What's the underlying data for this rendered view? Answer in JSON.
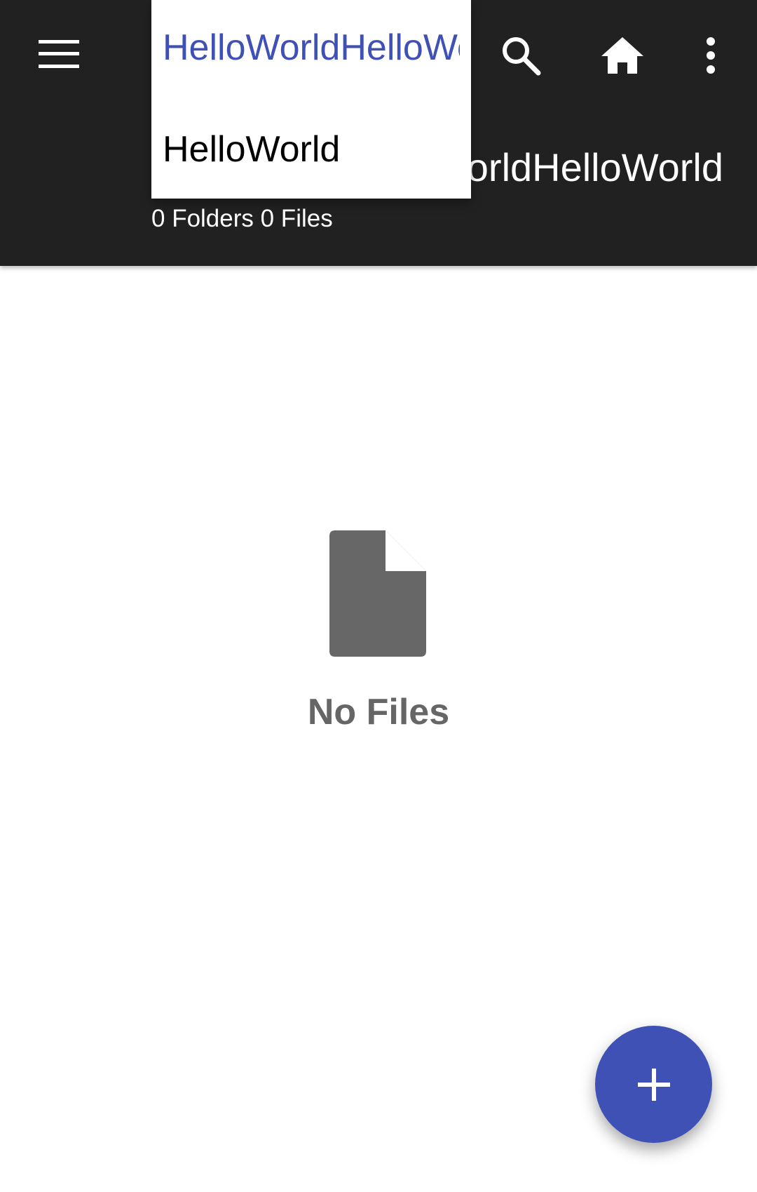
{
  "toolbar": {
    "menu_icon": "menu-icon",
    "search_icon": "search-icon",
    "home_icon": "home-icon",
    "more_icon": "more-vert-icon",
    "path_title": "HelloWorldHelloWorldHelloWorld",
    "counts": "0 Folders 0 Files",
    "background_color": "#212121"
  },
  "breadcrumb_dropdown": {
    "items": [
      {
        "label": "HelloWorldHelloWorld",
        "selected": true
      },
      {
        "label": "HelloWorld",
        "selected": false
      }
    ],
    "selected_color": "#3f51b5"
  },
  "empty_state": {
    "icon": "file-icon",
    "message": "No Files"
  },
  "fab": {
    "icon": "add-icon",
    "color": "#3f51b5"
  }
}
